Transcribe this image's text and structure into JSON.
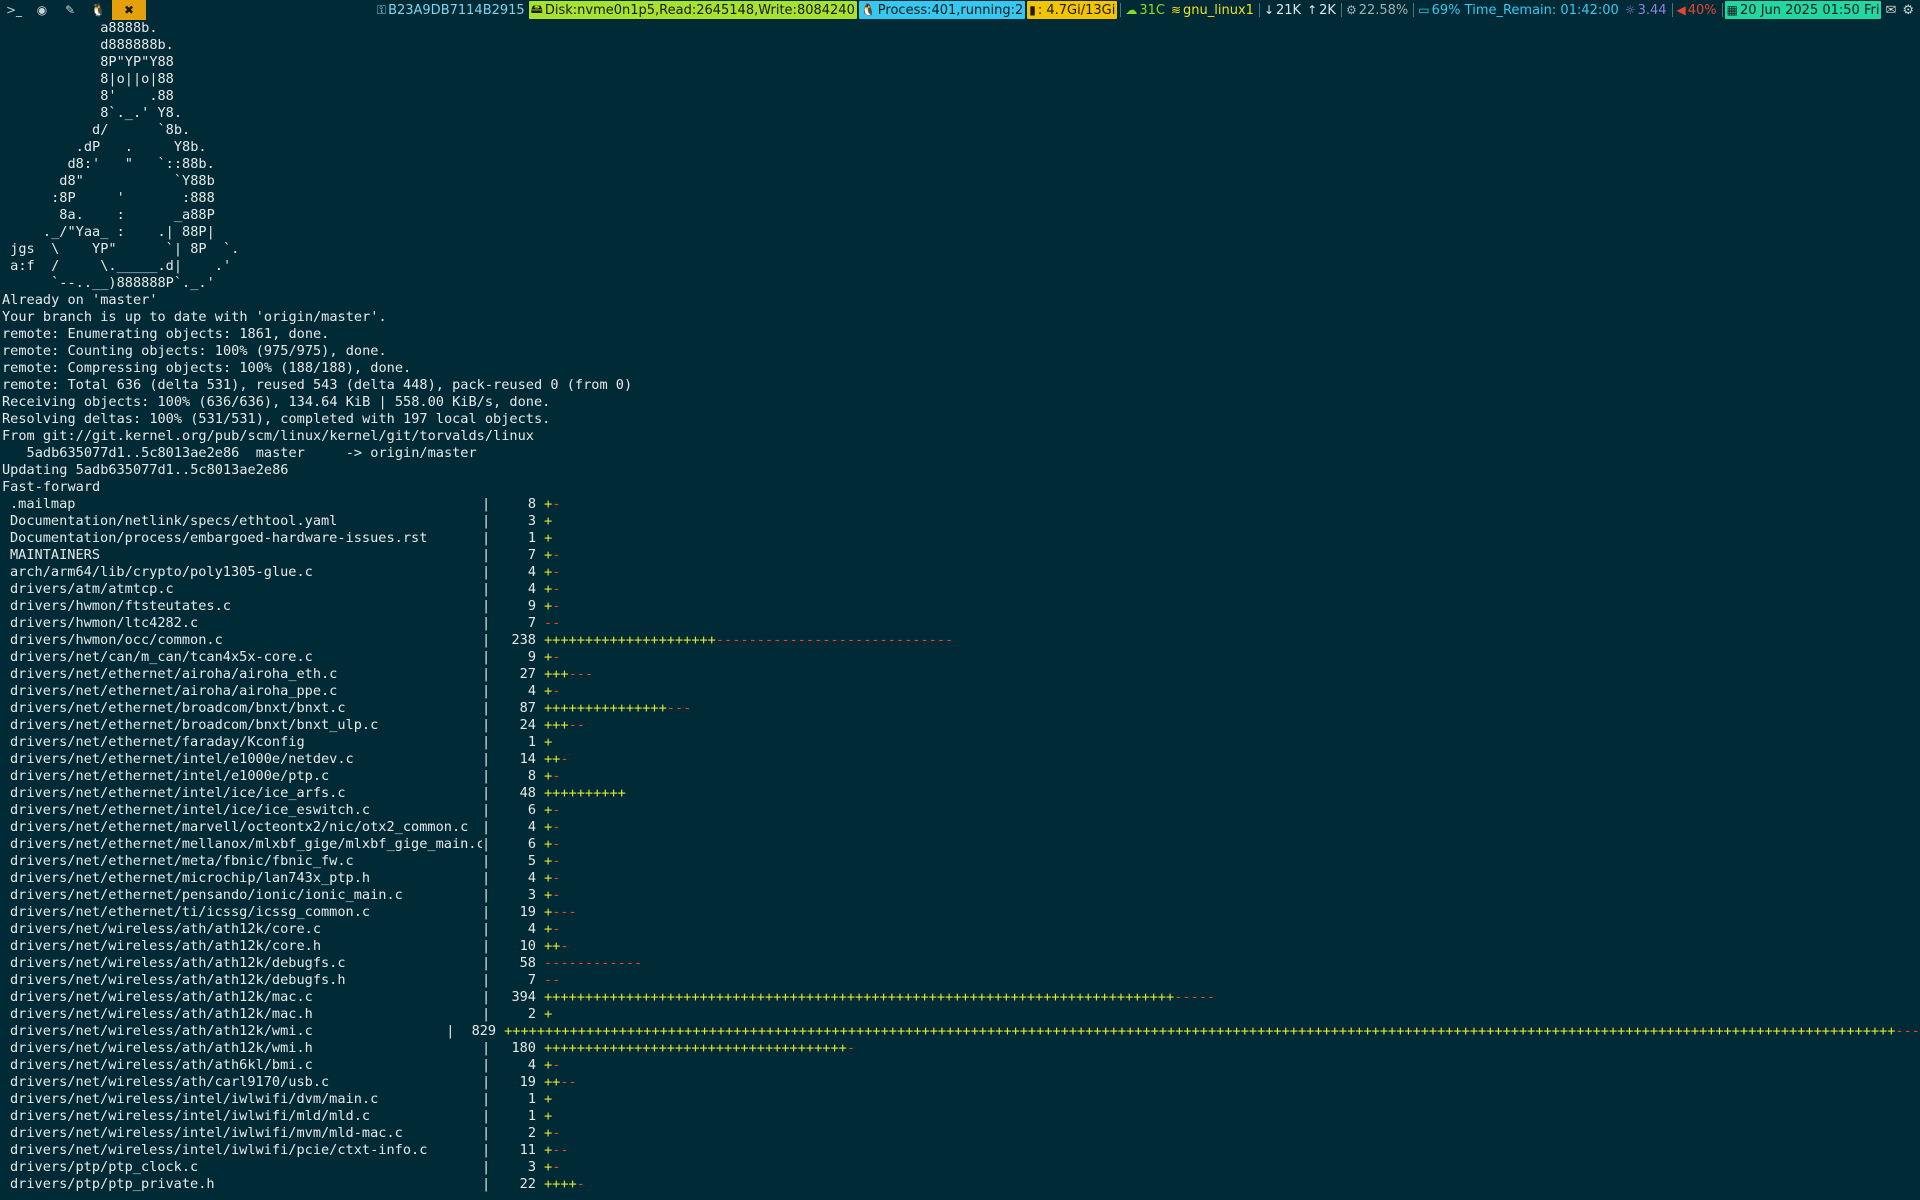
{
  "workspaces": [
    {
      "icon": "terminal-icon",
      "glyph": ">_",
      "active": false
    },
    {
      "icon": "browser-icon",
      "glyph": "◉",
      "active": false
    },
    {
      "icon": "editor-icon",
      "glyph": "✎",
      "active": false
    },
    {
      "icon": "linux-icon",
      "glyph": "🐧",
      "active": false
    },
    {
      "icon": "tools-icon",
      "glyph": "✖",
      "active": true
    }
  ],
  "statusbar": {
    "key": {
      "icon": "key-icon",
      "text": "B23A9DB7114B2915",
      "color": "#7ad7f0"
    },
    "disk": {
      "icon": "disk-icon",
      "text": "Disk:nvme0n1p5,Read:2645148,Write:8084240",
      "bg": "#a6e22e",
      "fg": "#1a1a1a"
    },
    "process": {
      "icon": "linux-icon",
      "text": "Process:401,running:2",
      "bg": "#35c8f0",
      "fg": "#1a1a1a"
    },
    "memory": {
      "icon": "bar-chart-icon",
      "text": ": 4.7Gi/13Gi",
      "bg": "#f5c400",
      "fg": "#1a1a1a"
    },
    "temp": {
      "icon": "cloud-icon",
      "text": "31C",
      "color": "#80e020"
    },
    "wifi": {
      "icon": "wifi-icon",
      "text": "gnu_linux1",
      "color": "#f0e020"
    },
    "down": {
      "icon": "arrow-down-icon",
      "text": "21K",
      "color": "#d8e8f0"
    },
    "up": {
      "icon": "arrow-up-icon",
      "text": "2K",
      "color": "#d8e8f0"
    },
    "cpu": {
      "icon": "gear-icon",
      "text": "22.58%",
      "color": "#9fb0b8"
    },
    "battery": {
      "icon": "battery-icon",
      "text": "69% Time_Remain: 01:42:00",
      "color": "#35c8f0"
    },
    "load": {
      "icon": "load-icon",
      "text": "3.44",
      "color": "#8a80e0"
    },
    "volume": {
      "icon": "volume-icon",
      "text": "40%",
      "color": "#e8442d"
    },
    "date": {
      "icon": "calendar-icon",
      "text": "20 Jun 2025 01:50 Fri",
      "bg": "#20d8a0",
      "fg": "#1a1a1a"
    },
    "tray1": {
      "icon": "mail-icon",
      "text": "✉"
    },
    "tray2": {
      "icon": "network-icon",
      "text": "⚙"
    }
  },
  "terminal": {
    "art": [
      "            a8888b.",
      "            d888888b.",
      "            8P\"YP\"Y88",
      "            8|o||o|88",
      "            8'    .88",
      "            8`._.' Y8.",
      "           d/      `8b.",
      "         .dP   .     Y8b.",
      "        d8:'   \"   `::88b.",
      "       d8\"           `Y88b",
      "      :8P     '       :888",
      "       8a.    :      _a88P",
      "     ._/\"Yaa_ :    .| 88P|",
      " jgs  \\    YP\"      `| 8P  `.",
      " a:f  /     \\._____.d|    .'",
      "      `--..__)888888P`._.'"
    ],
    "log": [
      "Already on 'master'",
      "Your branch is up to date with 'origin/master'.",
      "remote: Enumerating objects: 1861, done.",
      "remote: Counting objects: 100% (975/975), done.",
      "remote: Compressing objects: 100% (188/188), done.",
      "remote: Total 636 (delta 531), reused 543 (delta 448), pack-reused 0 (from 0)",
      "Receiving objects: 100% (636/636), 134.64 KiB | 558.00 KiB/s, done.",
      "Resolving deltas: 100% (531/531), completed with 197 local objects.",
      "From git://git.kernel.org/pub/scm/linux/kernel/git/torvalds/linux",
      "   5adb635077d1..5c8013ae2e86  master     -> origin/master",
      "Updating 5adb635077d1..5c8013ae2e86",
      "Fast-forward"
    ],
    "files": [
      {
        "name": ".mailmap",
        "count": "8",
        "plus": 1,
        "minus": 1
      },
      {
        "name": "Documentation/netlink/specs/ethtool.yaml",
        "count": "3",
        "plus": 1,
        "minus": 0
      },
      {
        "name": "Documentation/process/embargoed-hardware-issues.rst",
        "count": "1",
        "plus": 1,
        "minus": 0
      },
      {
        "name": "MAINTAINERS",
        "count": "7",
        "plus": 1,
        "minus": 1
      },
      {
        "name": "arch/arm64/lib/crypto/poly1305-glue.c",
        "count": "4",
        "plus": 1,
        "minus": 1
      },
      {
        "name": "drivers/atm/atmtcp.c",
        "count": "4",
        "plus": 1,
        "minus": 1
      },
      {
        "name": "drivers/hwmon/ftsteutates.c",
        "count": "9",
        "plus": 1,
        "minus": 1
      },
      {
        "name": "drivers/hwmon/ltc4282.c",
        "count": "7",
        "plus": 0,
        "minus": 2
      },
      {
        "name": "drivers/hwmon/occ/common.c",
        "count": "238",
        "plus": 21,
        "minus": 29
      },
      {
        "name": "drivers/net/can/m_can/tcan4x5x-core.c",
        "count": "9",
        "plus": 1,
        "minus": 1
      },
      {
        "name": "drivers/net/ethernet/airoha/airoha_eth.c",
        "count": "27",
        "plus": 3,
        "minus": 3
      },
      {
        "name": "drivers/net/ethernet/airoha/airoha_ppe.c",
        "count": "4",
        "plus": 1,
        "minus": 1
      },
      {
        "name": "drivers/net/ethernet/broadcom/bnxt/bnxt.c",
        "count": "87",
        "plus": 15,
        "minus": 3
      },
      {
        "name": "drivers/net/ethernet/broadcom/bnxt/bnxt_ulp.c",
        "count": "24",
        "plus": 3,
        "minus": 2
      },
      {
        "name": "drivers/net/ethernet/faraday/Kconfig",
        "count": "1",
        "plus": 1,
        "minus": 0
      },
      {
        "name": "drivers/net/ethernet/intel/e1000e/netdev.c",
        "count": "14",
        "plus": 2,
        "minus": 1
      },
      {
        "name": "drivers/net/ethernet/intel/e1000e/ptp.c",
        "count": "8",
        "plus": 1,
        "minus": 1
      },
      {
        "name": "drivers/net/ethernet/intel/ice/ice_arfs.c",
        "count": "48",
        "plus": 10,
        "minus": 0
      },
      {
        "name": "drivers/net/ethernet/intel/ice/ice_eswitch.c",
        "count": "6",
        "plus": 1,
        "minus": 1
      },
      {
        "name": "drivers/net/ethernet/marvell/octeontx2/nic/otx2_common.c",
        "count": "4",
        "plus": 1,
        "minus": 1
      },
      {
        "name": "drivers/net/ethernet/mellanox/mlxbf_gige/mlxbf_gige_main.c",
        "count": "6",
        "plus": 1,
        "minus": 1
      },
      {
        "name": "drivers/net/ethernet/meta/fbnic/fbnic_fw.c",
        "count": "5",
        "plus": 1,
        "minus": 1
      },
      {
        "name": "drivers/net/ethernet/microchip/lan743x_ptp.h",
        "count": "4",
        "plus": 1,
        "minus": 1
      },
      {
        "name": "drivers/net/ethernet/pensando/ionic/ionic_main.c",
        "count": "3",
        "plus": 1,
        "minus": 1
      },
      {
        "name": "drivers/net/ethernet/ti/icssg/icssg_common.c",
        "count": "19",
        "plus": 1,
        "minus": 3
      },
      {
        "name": "drivers/net/wireless/ath/ath12k/core.c",
        "count": "4",
        "plus": 1,
        "minus": 1
      },
      {
        "name": "drivers/net/wireless/ath/ath12k/core.h",
        "count": "10",
        "plus": 2,
        "minus": 1
      },
      {
        "name": "drivers/net/wireless/ath/ath12k/debugfs.c",
        "count": "58",
        "plus": 0,
        "minus": 12
      },
      {
        "name": "drivers/net/wireless/ath/ath12k/debugfs.h",
        "count": "7",
        "plus": 0,
        "minus": 2
      },
      {
        "name": "drivers/net/wireless/ath/ath12k/mac.c",
        "count": "394",
        "plus": 77,
        "minus": 5
      },
      {
        "name": "drivers/net/wireless/ath/ath12k/mac.h",
        "count": "2",
        "plus": 1,
        "minus": 0
      },
      {
        "name": "drivers/net/wireless/ath/ath12k/wmi.c",
        "count": "829",
        "plus": 170,
        "minus": 3
      },
      {
        "name": "drivers/net/wireless/ath/ath12k/wmi.h",
        "count": "180",
        "plus": 37,
        "minus": 1
      },
      {
        "name": "drivers/net/wireless/ath/ath6kl/bmi.c",
        "count": "4",
        "plus": 1,
        "minus": 1
      },
      {
        "name": "drivers/net/wireless/ath/carl9170/usb.c",
        "count": "19",
        "plus": 2,
        "minus": 2
      },
      {
        "name": "drivers/net/wireless/intel/iwlwifi/dvm/main.c",
        "count": "1",
        "plus": 1,
        "minus": 0
      },
      {
        "name": "drivers/net/wireless/intel/iwlwifi/mld/mld.c",
        "count": "1",
        "plus": 1,
        "minus": 0
      },
      {
        "name": "drivers/net/wireless/intel/iwlwifi/mvm/mld-mac.c",
        "count": "2",
        "plus": 1,
        "minus": 1
      },
      {
        "name": "drivers/net/wireless/intel/iwlwifi/pcie/ctxt-info.c",
        "count": "11",
        "plus": 1,
        "minus": 2
      },
      {
        "name": "drivers/ptp/ptp_clock.c",
        "count": "3",
        "plus": 1,
        "minus": 1
      },
      {
        "name": "drivers/ptp/ptp_private.h",
        "count": "22",
        "plus": 4,
        "minus": 1
      }
    ]
  }
}
